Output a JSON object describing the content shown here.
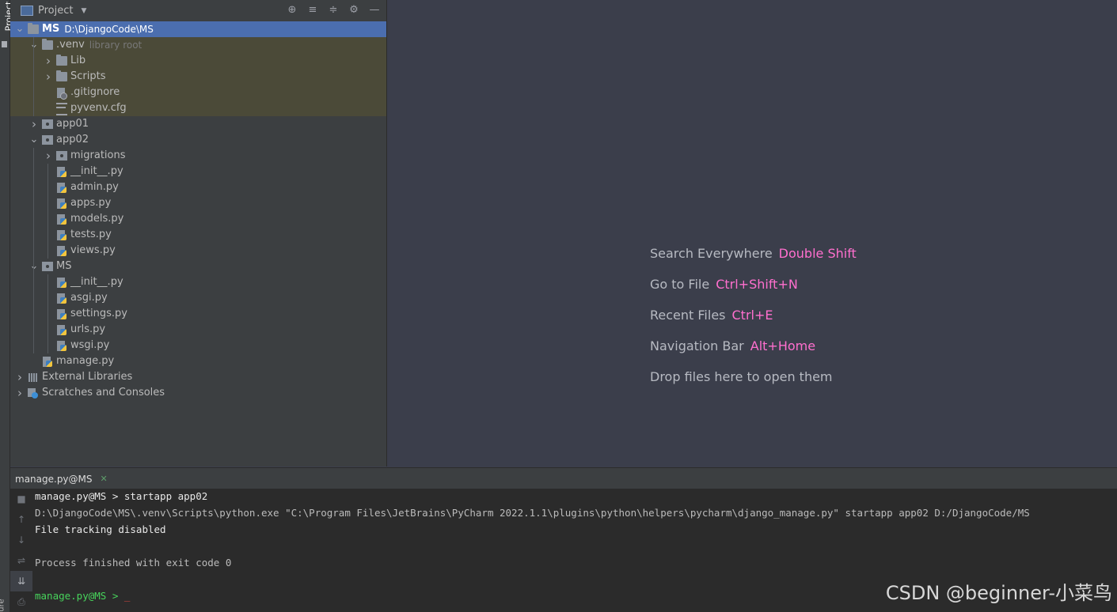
{
  "side_strip": {
    "project_label": "Project",
    "bottom_label": "ure"
  },
  "project_panel": {
    "title": "Project",
    "tree": [
      {
        "label": "MS",
        "path": "D:\\DjangoCode\\MS",
        "level": 0,
        "arrow": "down",
        "icon": "folder",
        "selected": true
      },
      {
        "label": ".venv",
        "hint": "library root",
        "level": 1,
        "arrow": "down",
        "icon": "folder",
        "library": true
      },
      {
        "label": "Lib",
        "level": 2,
        "arrow": "right",
        "icon": "folder",
        "library": true
      },
      {
        "label": "Scripts",
        "level": 2,
        "arrow": "right",
        "icon": "folder",
        "library": true
      },
      {
        "label": ".gitignore",
        "level": 2,
        "arrow": "",
        "icon": "git",
        "library": true
      },
      {
        "label": "pyvenv.cfg",
        "level": 2,
        "arrow": "",
        "icon": "text",
        "library": true
      },
      {
        "label": "app01",
        "level": 1,
        "arrow": "right",
        "icon": "package"
      },
      {
        "label": "app02",
        "level": 1,
        "arrow": "down",
        "icon": "package"
      },
      {
        "label": "migrations",
        "level": 2,
        "arrow": "right",
        "icon": "package"
      },
      {
        "label": "__init__.py",
        "level": 2,
        "arrow": "",
        "icon": "python"
      },
      {
        "label": "admin.py",
        "level": 2,
        "arrow": "",
        "icon": "python"
      },
      {
        "label": "apps.py",
        "level": 2,
        "arrow": "",
        "icon": "python"
      },
      {
        "label": "models.py",
        "level": 2,
        "arrow": "",
        "icon": "python"
      },
      {
        "label": "tests.py",
        "level": 2,
        "arrow": "",
        "icon": "python"
      },
      {
        "label": "views.py",
        "level": 2,
        "arrow": "",
        "icon": "python"
      },
      {
        "label": "MS",
        "level": 1,
        "arrow": "down",
        "icon": "package"
      },
      {
        "label": "__init__.py",
        "level": 2,
        "arrow": "",
        "icon": "python"
      },
      {
        "label": "asgi.py",
        "level": 2,
        "arrow": "",
        "icon": "python"
      },
      {
        "label": "settings.py",
        "level": 2,
        "arrow": "",
        "icon": "python"
      },
      {
        "label": "urls.py",
        "level": 2,
        "arrow": "",
        "icon": "python"
      },
      {
        "label": "wsgi.py",
        "level": 2,
        "arrow": "",
        "icon": "python"
      },
      {
        "label": "manage.py",
        "level": 1,
        "arrow": "",
        "icon": "python"
      },
      {
        "label": "External Libraries",
        "level": 0,
        "arrow": "right",
        "icon": "libraries"
      },
      {
        "label": "Scratches and Consoles",
        "level": 0,
        "arrow": "right",
        "icon": "scratch"
      }
    ]
  },
  "editor_hints": [
    {
      "text": "Search Everywhere",
      "key": "Double Shift"
    },
    {
      "text": "Go to File",
      "key": "Ctrl+Shift+N"
    },
    {
      "text": "Recent Files",
      "key": "Ctrl+E"
    },
    {
      "text": "Navigation Bar",
      "key": "Alt+Home"
    },
    {
      "text": "Drop files here to open them",
      "key": ""
    }
  ],
  "run_panel": {
    "tab_label": "manage.py@MS",
    "lines": {
      "cmd": "manage.py@MS > startapp app02",
      "exec": "D:\\DjangoCode\\MS\\.venv\\Scripts\\python.exe \"C:\\Program Files\\JetBrains\\PyCharm 2022.1.1\\plugins\\python\\helpers\\pycharm\\django_manage.py\" startapp app02 D:/DjangoCode/MS",
      "tracking": "File tracking disabled",
      "finished": "Process finished with exit code 0",
      "prompt": "manage.py@MS > "
    }
  },
  "watermark": "CSDN @beginner-小菜鸟",
  "colors": {
    "accent_key": "#ff6fce",
    "console_green": "#47d35b",
    "selection": "#4b6eaf",
    "library_bg": "#4b4a38"
  }
}
